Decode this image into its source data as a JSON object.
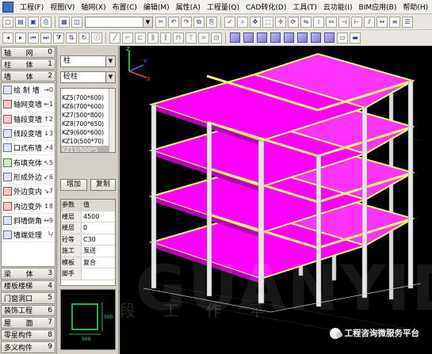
{
  "menu": [
    "工程(F)",
    "视图(V)",
    "轴网(X)",
    "布置(C)",
    "编辑(M)",
    "属性(A)",
    "工程量(Q)",
    "CAD转化(D)",
    "工具(T)",
    "云功能(I)",
    "BIM应用(B)",
    "帮助(H)"
  ],
  "modules": {
    "axis": {
      "label": "轴",
      "label2": "网",
      "key": "0"
    },
    "column": {
      "label": "柱",
      "label2": "体",
      "key": "1"
    },
    "wall": {
      "label": "墙",
      "label2": "体",
      "key": "2"
    },
    "beam": {
      "label": "梁",
      "label2": "体",
      "key": "3"
    },
    "slab": {
      "label": "楼板楼梯",
      "key": "4"
    },
    "door": {
      "label": "门窗洞口",
      "key": "5"
    },
    "decor": {
      "label": "装饰工程",
      "key": "6"
    },
    "roof": {
      "label": "屋",
      "label2": "面",
      "key": "7"
    },
    "members": {
      "label": "零星构件",
      "key": "8"
    },
    "misc": {
      "label": "多义构件",
      "key": "9"
    }
  },
  "wall_tools": [
    {
      "label": "绘 制 墙",
      "key": "→0",
      "icon": "draw-wall-icon"
    },
    {
      "label": "轴网变墙",
      "key": "←1",
      "icon": "axis-to-wall-icon"
    },
    {
      "label": "轴段变墙",
      "key": "↑2",
      "icon": "axis-segment-wall-icon"
    },
    {
      "label": "线段变墙",
      "key": "↓3",
      "icon": "line-to-wall-icon"
    },
    {
      "label": "口式布墙",
      "key": "↗4",
      "icon": "frame-wall-icon"
    },
    {
      "label": "布填充体",
      "key": "↖5",
      "icon": "fill-body-icon"
    },
    {
      "label": "形成外边",
      "key": "↙6",
      "icon": "outer-edge-icon"
    },
    {
      "label": "外边变内",
      "key": "↘7",
      "icon": "outer-to-inner-icon"
    },
    {
      "label": "内边变外",
      "key": "↕8",
      "icon": "inner-to-outer-icon"
    },
    {
      "label": "斜墙倒角",
      "key": "↔9",
      "icon": "chamfer-icon"
    },
    {
      "label": "墙端处理",
      "key": "└/",
      "icon": "wall-end-icon"
    }
  ],
  "selectors": {
    "type": "柱",
    "subtype": "砼柱"
  },
  "components": [
    "KZ5(700*600)",
    "KZ6(700*600)",
    "KZ7(500*800)",
    "KZ8(700*650)",
    "KZ9(600*600)",
    "KZ10(500*70)",
    "KZ11(500*5"
  ],
  "selected_component_index": 6,
  "buttons": {
    "add": "增加",
    "copy": "复制"
  },
  "properties": [
    {
      "k": "参数",
      "v": "值"
    },
    {
      "k": "楼层",
      "v": "4500"
    },
    {
      "k": "楼层",
      "v": "0"
    },
    {
      "k": "砼等",
      "v": "C30"
    },
    {
      "k": "施工",
      "v": "泵送"
    },
    {
      "k": "模板",
      "v": "复合"
    },
    {
      "k": "脚手",
      "v": ""
    }
  ],
  "preview_dims": {
    "width": "500",
    "height": "500"
  },
  "watermark": {
    "text": "GUANYIDE",
    "cn": "段  工  作  苹"
  },
  "brand": "工程咨询微服务平台",
  "colors": {
    "slab": "#ff00ff",
    "beam": "#ffff66",
    "column": "#d9d9d9",
    "background": "#000000"
  }
}
